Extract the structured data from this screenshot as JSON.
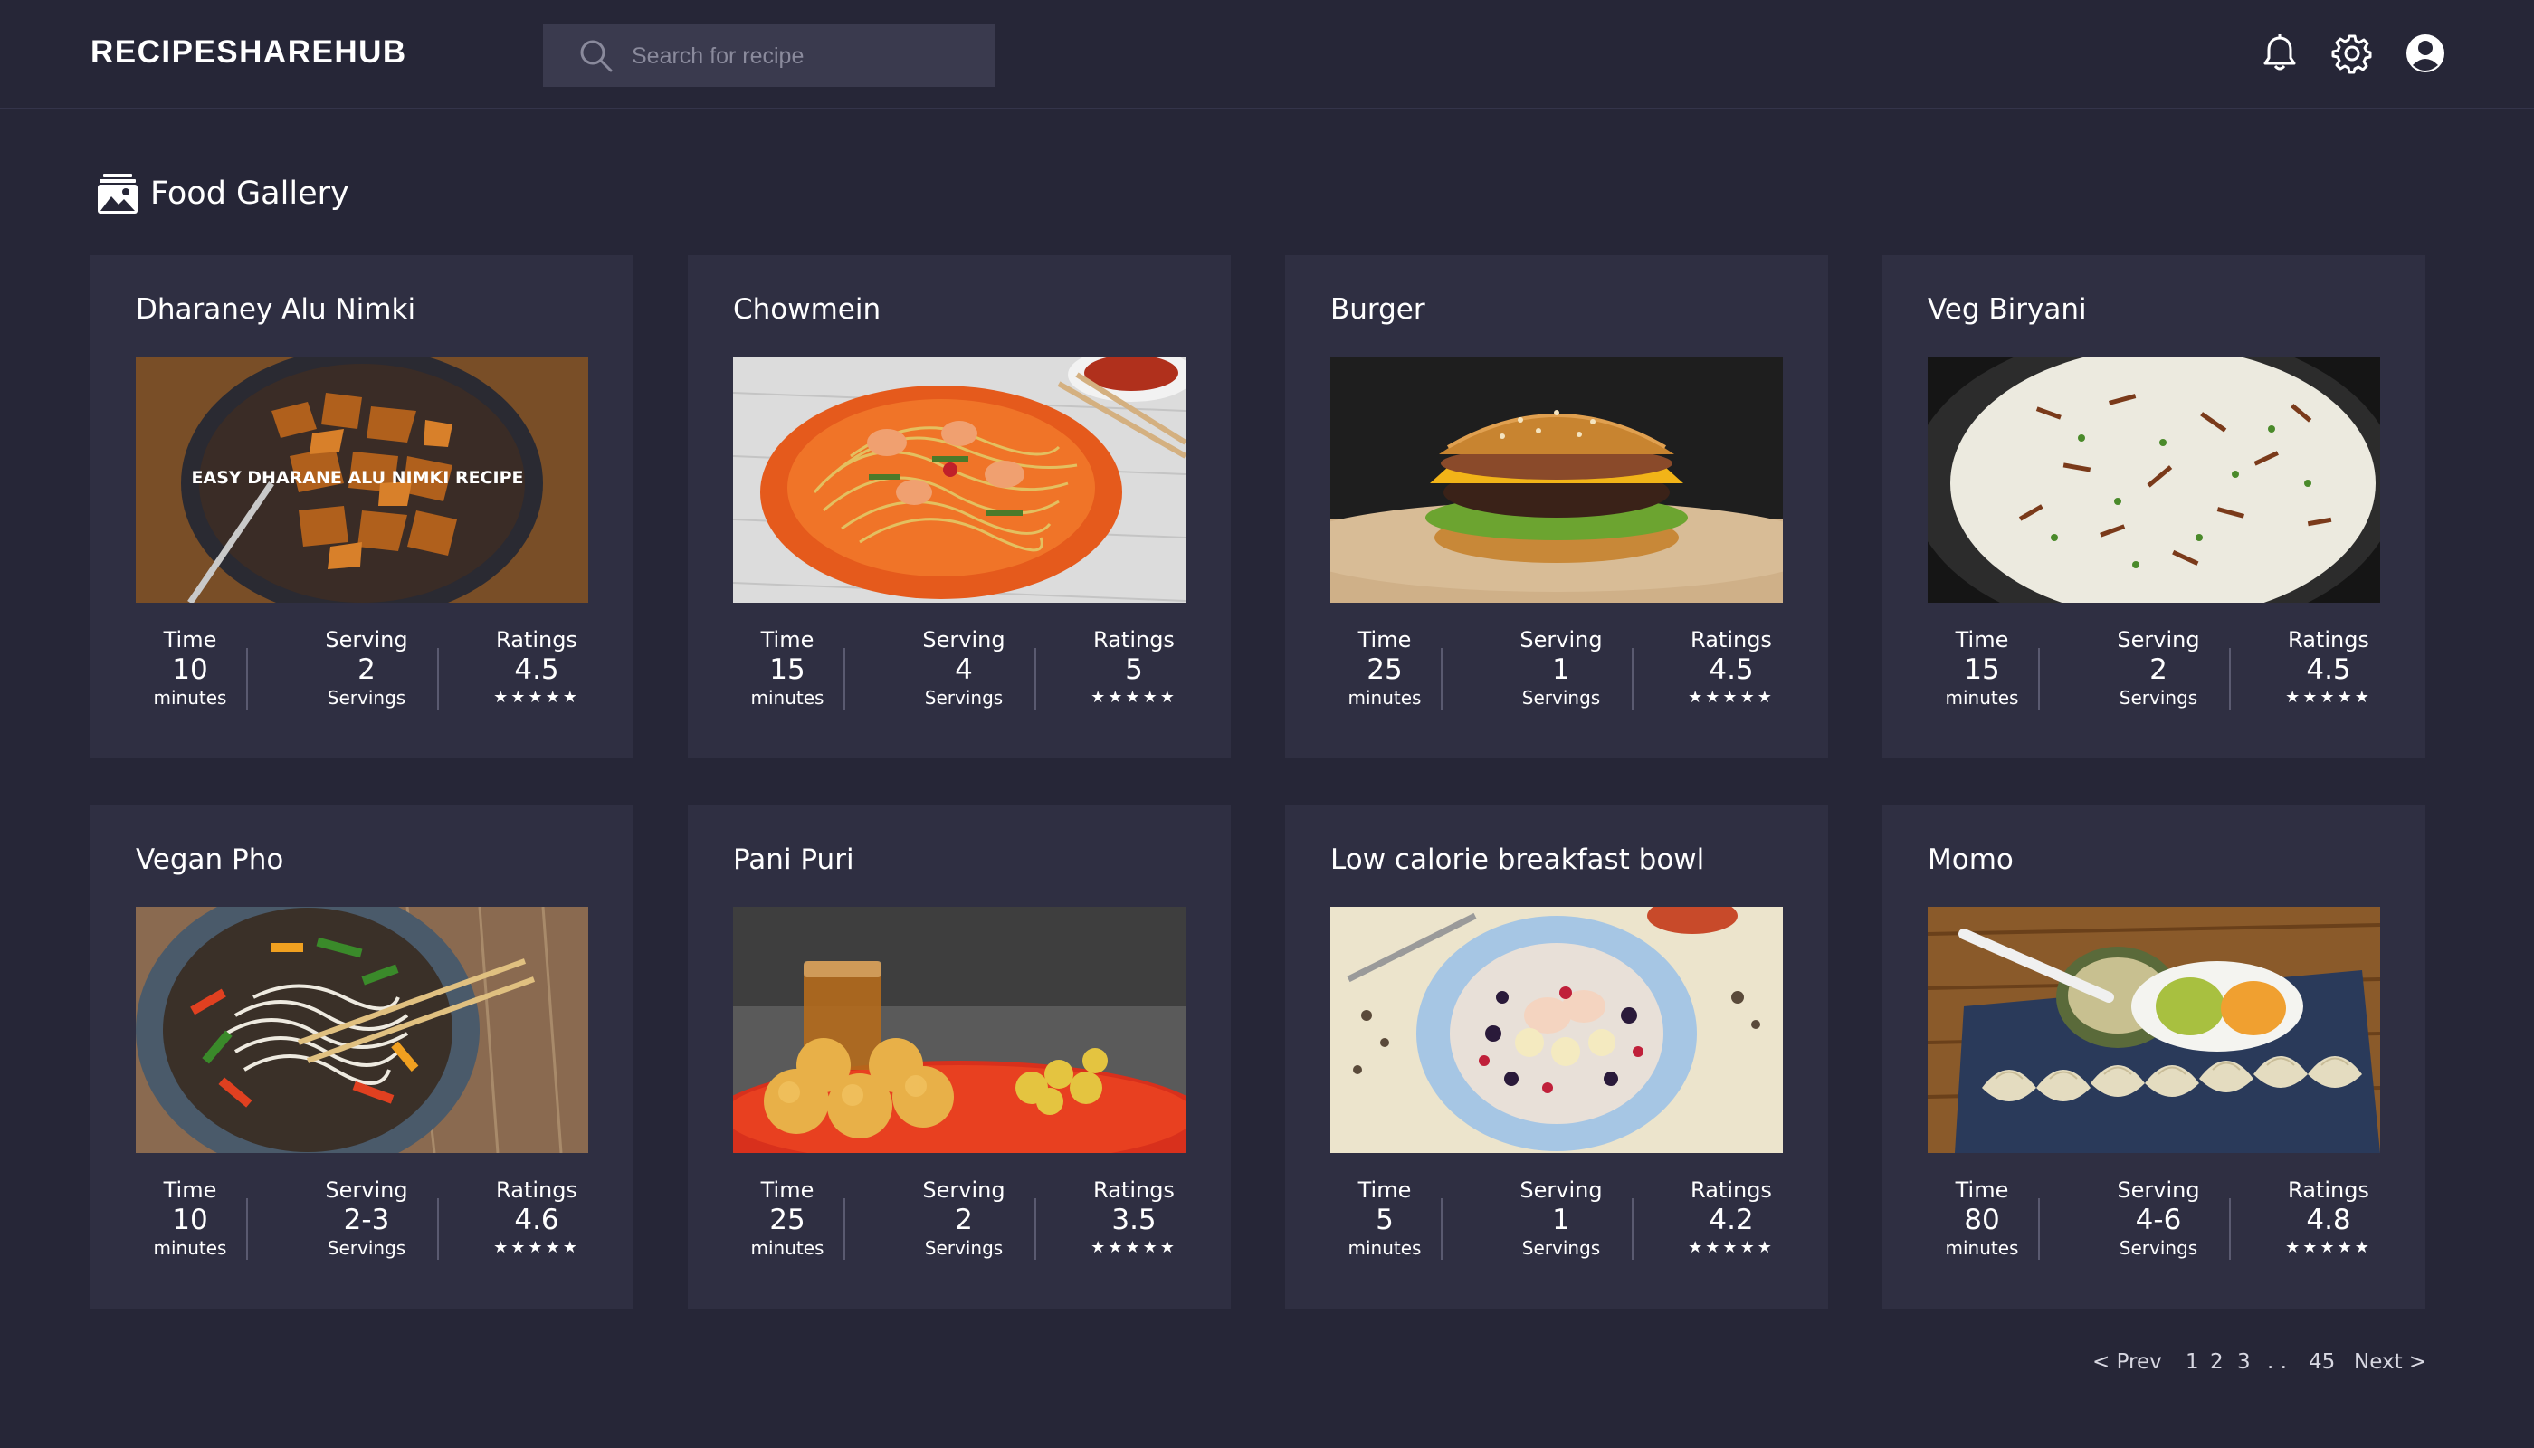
{
  "app": {
    "brand": "RECIPESHAREHUB"
  },
  "search": {
    "placeholder": "Search for recipe"
  },
  "header_icons": [
    "bell-icon",
    "gear-icon",
    "user-icon"
  ],
  "gallery": {
    "title": "Food Gallery",
    "icon": "gallery-icon"
  },
  "labels": {
    "time": "Time",
    "serving": "Serving",
    "ratings": "Ratings",
    "minutes": "minutes",
    "servings": "Servings",
    "stars": "★★★★★"
  },
  "recipes": [
    {
      "name": "Dharaney Alu Nimki",
      "time": "10",
      "serving": "2",
      "rating": "4.5",
      "image_caption": "EASY DHARANE ALU NIMKI RECIPE"
    },
    {
      "name": "Chowmein",
      "time": "15",
      "serving": "4",
      "rating": "5"
    },
    {
      "name": "Burger",
      "time": "25",
      "serving": "1",
      "rating": "4.5"
    },
    {
      "name": "Veg Biryani",
      "time": "15",
      "serving": "2",
      "rating": "4.5"
    },
    {
      "name": "Vegan Pho",
      "time": "10",
      "serving": "2-3",
      "rating": "4.6"
    },
    {
      "name": "Pani Puri",
      "time": "25",
      "serving": "2",
      "rating": "3.5"
    },
    {
      "name": "Low calorie breakfast bowl",
      "time": "5",
      "serving": "1",
      "rating": "4.2"
    },
    {
      "name": "Momo",
      "time": "80",
      "serving": "4-6",
      "rating": "4.8"
    }
  ],
  "pagination": {
    "prev": "< Prev",
    "pages": [
      "1",
      "2",
      "3"
    ],
    "ellipsis": ". .",
    "last": "45",
    "next": "Next >"
  },
  "colors": {
    "background": "#262637",
    "card": "#2f2f42",
    "search_bg": "#3a3a4e"
  }
}
